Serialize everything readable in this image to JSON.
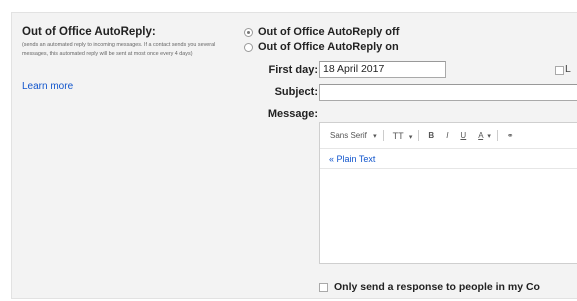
{
  "section": {
    "title": "Out of Office AutoReply:",
    "description": "(sends an automated reply to incoming messages. If a contact sends you several messages, this automated reply will be sent at most once every 4 days)",
    "learn_more": "Learn more"
  },
  "options": {
    "off_label": "Out of Office AutoReply off",
    "on_label": "Out of Office AutoReply on",
    "selected": "off"
  },
  "form": {
    "first_day_label": "First day:",
    "first_day_value": "18 April 2017",
    "last_day_checkbox_label": "L",
    "subject_label": "Subject:",
    "subject_value": "",
    "message_label": "Message:"
  },
  "editor": {
    "font_label": "Sans Serif",
    "font_caret": "▾",
    "size_label": "TT",
    "size_caret": "▾",
    "bold": "B",
    "italic": "I",
    "underline": "U",
    "text_color": "A",
    "text_color_caret": "▾",
    "plain_text_link": "« Plain Text"
  },
  "footer": {
    "contacts_only_label": "Only send a response to people in my Co"
  },
  "colors": {
    "panel_bg": "#f3f3f3",
    "link": "#1155cc"
  }
}
